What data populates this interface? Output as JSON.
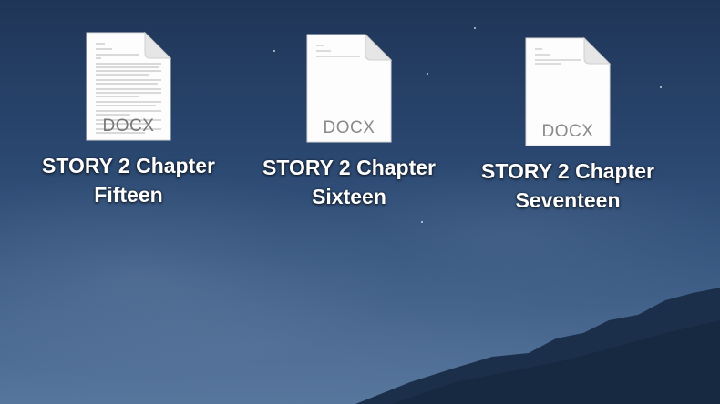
{
  "desktop": {
    "files": [
      {
        "name_line1": "STORY 2 Chapter",
        "name_line2": "Fifteen",
        "extension": "DOCX",
        "preview": "dense",
        "icon": "docx-file-icon"
      },
      {
        "name_line1": "STORY 2 Chapter",
        "name_line2": "Sixteen",
        "extension": "DOCX",
        "preview": "sparse",
        "icon": "docx-file-icon"
      },
      {
        "name_line1": "STORY 2 Chapter",
        "name_line2": "Seventeen",
        "extension": "DOCX",
        "preview": "sparse",
        "icon": "docx-file-icon"
      }
    ],
    "colors": {
      "sky_top": "#1f3557",
      "sky_bottom": "#56769c",
      "label_text": "#ffffff",
      "mountain": "#1c2f4a"
    }
  }
}
